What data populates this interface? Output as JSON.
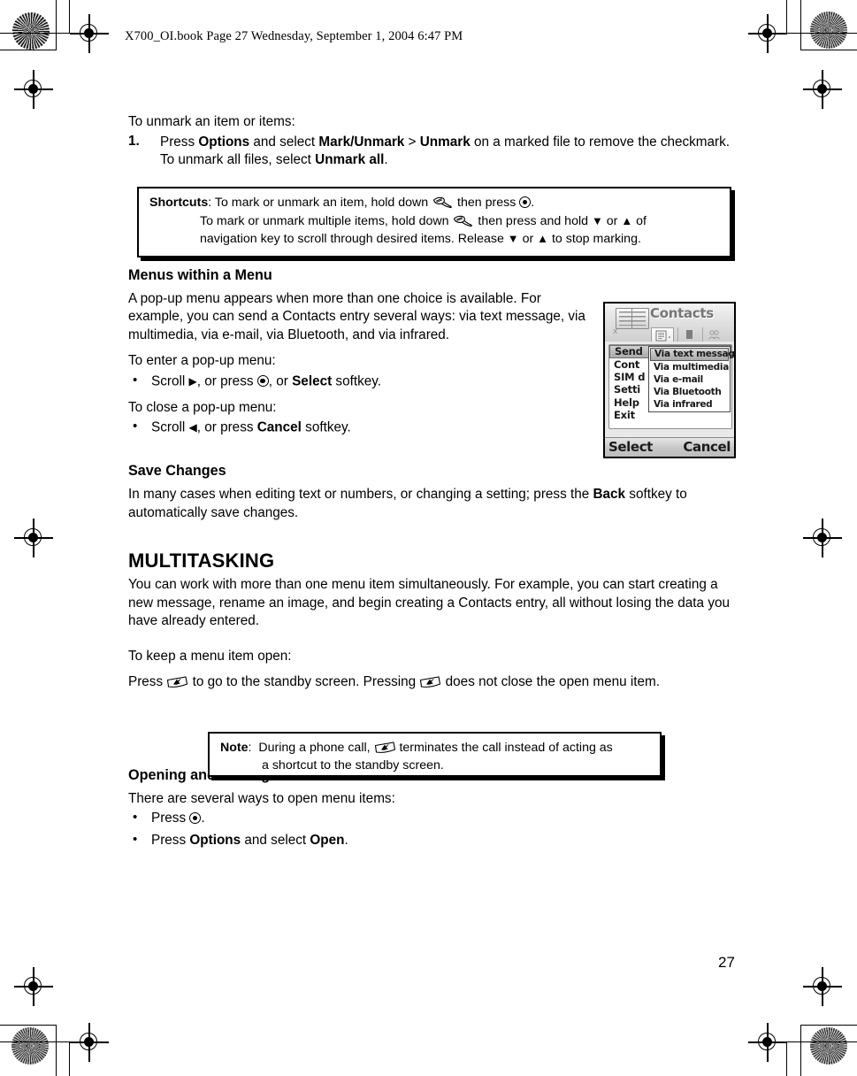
{
  "header": {
    "file_line": "X700_OI.book  Page 27  Wednesday, September 1, 2004  6:47 PM"
  },
  "page_number": "27",
  "body": {
    "intro_line": "To unmark an item or items:",
    "step1": {
      "number": "1.",
      "text_a": "Press ",
      "bold_options": "Options",
      "text_b": " and select ",
      "bold_markunmark": "Mark/Unmark",
      "text_c": " > ",
      "bold_unmark": "Unmark",
      "text_d": " on a marked file to remove the checkmark. To unmark all files, select ",
      "bold_unmark_all": "Unmark all",
      "text_e": "."
    },
    "shortcuts_box": {
      "label": "Shortcuts",
      "colon": ":",
      "line1_a": "To mark or unmark an item, hold down ",
      "line1_b": " then press ",
      "line1_c": ".",
      "line2_a": "To mark or unmark multiple items, hold down ",
      "line2_b": " then press and hold ",
      "line2_down": "▼",
      "line2_or": " or ",
      "line2_up": "▲",
      "line2_c": " of",
      "line3_a": "navigation key to scroll through desired items. Release ",
      "line3_down": "▼",
      "line3_or": " or ",
      "line3_up": "▲",
      "line3_b": " to stop marking."
    },
    "menus_section": {
      "heading": "Menus within a Menu",
      "paragraph": "A pop-up menu appears when more than one choice is available. For example, you can send a Contacts entry several ways: via text message, via multimedia, via e-mail, via Bluetooth, and via infrared.",
      "enter_lead": "To enter a pop-up menu:",
      "enter_bullet_a": "Scroll ",
      "enter_bullet_right": "▶",
      "enter_bullet_b": ", or press ",
      "enter_bullet_c": ", or ",
      "enter_bullet_select": "Select",
      "enter_bullet_d": " softkey.",
      "close_lead": "To close a pop-up menu:",
      "close_bullet_a": "Scroll ",
      "close_bullet_left": "◀",
      "close_bullet_b": ", or press ",
      "close_bullet_cancel": "Cancel",
      "close_bullet_c": " softkey."
    },
    "save_section": {
      "heading": "Save Changes",
      "text_a": "In many cases when editing text or numbers, or changing a setting; press the ",
      "bold_back": "Back",
      "text_b": " softkey to automatically save changes."
    },
    "multitasking_section": {
      "heading": "MULTITASKING",
      "paragraph": "You can work with more than one menu item simultaneously. For example, you can start creating a new message, rename an image, and begin creating a Contacts entry, all without losing the data you have already entered.",
      "keep_lead": "To keep a menu item open:",
      "keep_a": "Press ",
      "keep_b": " to go to the standby screen. Pressing ",
      "keep_c": " does not close the open menu item."
    },
    "note_box": {
      "label": "Note",
      "colon": ":",
      "line1_a": "During a phone call, ",
      "line1_b": " terminates the call instead of acting as",
      "line2": "a shortcut to the standby screen."
    },
    "opening_section": {
      "heading": "Opening and closing menu items",
      "lead": "There are several ways to open menu items:",
      "bullet1_a": "Press ",
      "bullet1_b": ".",
      "bullet2_a": "Press ",
      "bullet2_options": "Options",
      "bullet2_b": " and select ",
      "bullet2_open": "Open",
      "bullet2_c": "."
    }
  },
  "phone_screenshot": {
    "title": "Contacts",
    "menu_items": [
      "Send",
      "Cont",
      "SIM d",
      "Setti",
      "Help",
      "Exit"
    ],
    "popup_items": [
      "Via text message",
      "Via multimedia",
      "Via e-mail",
      "Via Bluetooth",
      "Via infrared"
    ],
    "selected_menu_index": 0,
    "selected_popup_index": 0,
    "softkey_left": "Select",
    "softkey_right": "Cancel"
  }
}
